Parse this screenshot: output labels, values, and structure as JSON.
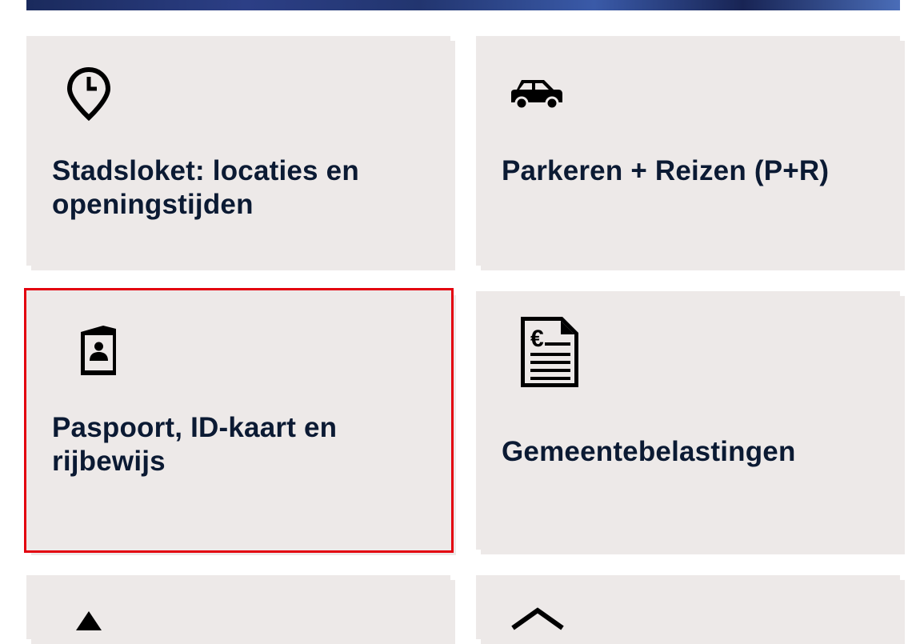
{
  "tiles": [
    {
      "title": "Stadsloket: locaties en openingstijden",
      "icon": "location-clock-icon"
    },
    {
      "title": "Parkeren + Reizen (P+R)",
      "icon": "car-icon"
    },
    {
      "title": "Paspoort, ID-kaart en rijbewijs",
      "icon": "passport-icon"
    },
    {
      "title": "Gemeentebelastingen",
      "icon": "tax-bill-euro-icon"
    },
    {
      "title": "",
      "icon": "tree-icon"
    },
    {
      "title": "",
      "icon": "house-icon"
    }
  ],
  "colors": {
    "tile_background": "#ede9e8",
    "title_text": "#0b1a33",
    "focus_outline": "#e3000f"
  }
}
